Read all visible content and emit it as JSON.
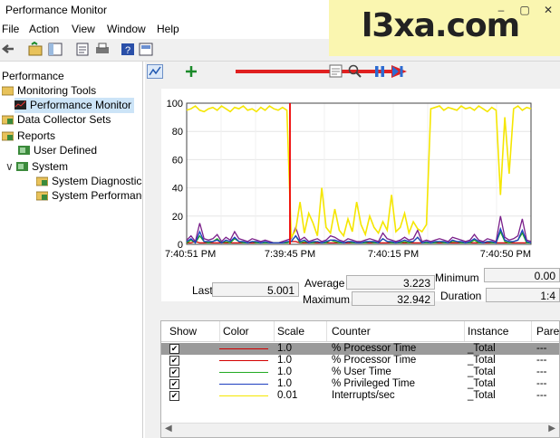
{
  "window": {
    "title": "Performance Monitor",
    "min": "–",
    "max": "▢",
    "close": "✕"
  },
  "menu": [
    "File",
    "Action",
    "View",
    "Window",
    "Help"
  ],
  "tree": {
    "root": "Performance",
    "monitoring_tools": "Monitoring Tools",
    "performance_monitor": "Performance Monitor",
    "data_collector_sets": "Data Collector Sets",
    "reports": "Reports",
    "user_defined": "User Defined",
    "system": "System",
    "system_diagnostics": "System Diagnostics",
    "system_performance": "System Performanc"
  },
  "chart_data": {
    "type": "line",
    "ylim": [
      0,
      100
    ],
    "yticks": [
      "100",
      "80",
      "60",
      "40",
      "20",
      "0"
    ],
    "xticks": [
      "7:40:51 PM",
      "7:39:45 PM",
      "7:40:15 PM",
      "7:40:50 PM"
    ],
    "series": [
      {
        "name": "% Processor Time",
        "color": "#d40000",
        "values": [
          1,
          1,
          2,
          1,
          1,
          1,
          1,
          1,
          1,
          1,
          1,
          1,
          1,
          1,
          1,
          1,
          1,
          1,
          1,
          1,
          1,
          1,
          1,
          1,
          2,
          2,
          1,
          1,
          1,
          1,
          1,
          1,
          1,
          1,
          1,
          1,
          1,
          1,
          1,
          1,
          1,
          1,
          1,
          1,
          1,
          1,
          1,
          1,
          1,
          1,
          1,
          1,
          1,
          1,
          1,
          1,
          1,
          1,
          1,
          1,
          1,
          1,
          1,
          1,
          1,
          1,
          1,
          1,
          1,
          1,
          1,
          1,
          1,
          1,
          1,
          1,
          1,
          1,
          1,
          1
        ]
      },
      {
        "name": "% Processor Time",
        "color": "#7a1f8a",
        "values": [
          3,
          6,
          2,
          15,
          4,
          3,
          4,
          7,
          2,
          5,
          3,
          9,
          4,
          3,
          2,
          4,
          3,
          2,
          3,
          2,
          1,
          1,
          2,
          3,
          4,
          12,
          3,
          5,
          2,
          3,
          4,
          2,
          3,
          6,
          5,
          3,
          2,
          4,
          3,
          2,
          2,
          3,
          4,
          3,
          2,
          8,
          4,
          3,
          2,
          3,
          5,
          3,
          4,
          10,
          2,
          3,
          2,
          3,
          4,
          3,
          2,
          5,
          4,
          3,
          2,
          3,
          7,
          3,
          2,
          4,
          3,
          2,
          20,
          5,
          3,
          4,
          6,
          18,
          3,
          2
        ]
      },
      {
        "name": "% User Time",
        "color": "#22aa22",
        "values": [
          1,
          3,
          1,
          6,
          2,
          1,
          2,
          4,
          1,
          2,
          1,
          4,
          2,
          1,
          1,
          2,
          1,
          1,
          1,
          1,
          1,
          1,
          1,
          1,
          2,
          6,
          1,
          2,
          1,
          1,
          2,
          1,
          1,
          3,
          2,
          1,
          1,
          2,
          1,
          1,
          1,
          1,
          2,
          1,
          1,
          4,
          2,
          1,
          1,
          1,
          2,
          1,
          2,
          5,
          1,
          1,
          1,
          1,
          2,
          1,
          1,
          2,
          2,
          1,
          1,
          1,
          3,
          1,
          1,
          2,
          1,
          1,
          9,
          2,
          1,
          2,
          3,
          8,
          1,
          1
        ]
      },
      {
        "name": "% Privileged Time",
        "color": "#1d3fbf",
        "values": [
          2,
          4,
          1,
          9,
          2,
          2,
          2,
          3,
          1,
          3,
          2,
          5,
          2,
          2,
          1,
          2,
          2,
          1,
          2,
          1,
          1,
          1,
          1,
          2,
          2,
          6,
          2,
          3,
          1,
          2,
          2,
          1,
          2,
          3,
          3,
          2,
          1,
          2,
          2,
          1,
          1,
          2,
          2,
          2,
          1,
          4,
          2,
          2,
          1,
          2,
          3,
          2,
          2,
          5,
          1,
          2,
          1,
          2,
          2,
          2,
          1,
          3,
          2,
          2,
          1,
          2,
          4,
          2,
          1,
          2,
          2,
          1,
          11,
          3,
          2,
          2,
          3,
          10,
          2,
          1
        ]
      },
      {
        "name": "Interrupts/sec",
        "color": "#f5e600",
        "values": [
          95,
          96,
          98,
          95,
          94,
          96,
          97,
          95,
          98,
          96,
          94,
          97,
          96,
          98,
          95,
          96,
          94,
          97,
          95,
          98,
          96,
          95,
          97,
          95,
          5,
          10,
          30,
          8,
          22,
          15,
          6,
          40,
          12,
          8,
          25,
          10,
          6,
          18,
          9,
          30,
          14,
          7,
          20,
          12,
          8,
          16,
          10,
          35,
          9,
          12,
          22,
          8,
          16,
          11,
          9,
          14,
          96,
          97,
          98,
          95,
          97,
          96,
          95,
          98,
          96,
          97,
          95,
          98,
          96,
          94,
          97,
          95,
          35,
          90,
          50,
          96,
          98,
          95,
          97,
          96
        ]
      }
    ]
  },
  "stats": {
    "last_label": "Last",
    "last_value": "5.001",
    "average_label": "Average",
    "average_value": "3.223",
    "minimum_label": "Minimum",
    "minimum_value": "0.00",
    "maximum_label": "Maximum",
    "maximum_value": "32.942",
    "duration_label": "Duration",
    "duration_value": "1:4"
  },
  "legend_table": {
    "headers": [
      "Show",
      "Color",
      "Scale",
      "Counter",
      "Instance",
      "Pare"
    ],
    "rows": [
      {
        "color": "#d40000",
        "scale": "1.0",
        "counter": "% Processor Time",
        "instance": "_Total",
        "parent": "---"
      },
      {
        "color": "#7a1f8a",
        "scale": "1.0",
        "counter": "% Processor Time",
        "instance": "_Total",
        "parent": "---"
      },
      {
        "color": "#22aa22",
        "scale": "1.0",
        "counter": "% User Time",
        "instance": "_Total",
        "parent": "---"
      },
      {
        "color": "#1d3fbf",
        "scale": "1.0",
        "counter": "% Privileged Time",
        "instance": "_Total",
        "parent": "---"
      },
      {
        "color": "#f5e600",
        "scale": "0.01",
        "counter": "Interrupts/sec",
        "instance": "_Total",
        "parent": "---"
      }
    ],
    "check": "✔"
  },
  "watermark": "l3xa.com"
}
